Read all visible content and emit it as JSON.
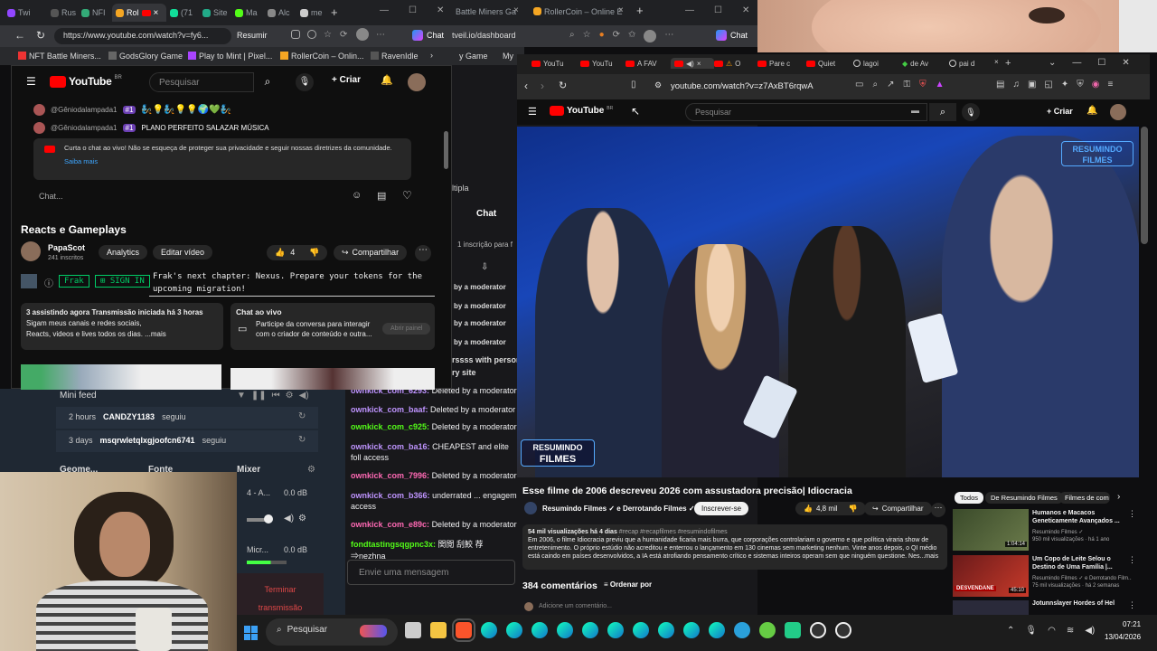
{
  "back_browser": {
    "tabs": [
      "Twi",
      "Rus",
      "NFI",
      "Rol",
      "(71",
      "Site",
      "Ma",
      "Alc",
      "me"
    ],
    "tabs2": [
      "Battle Miners Ga",
      "RollerCoin – Online E"
    ],
    "url_left": "https://www.youtube.com/watch?v=fy6...",
    "resumir": "Resumir",
    "chat_label": "Chat",
    "url_right": "tveil.io/dashboard",
    "chat_label2": "Chat"
  },
  "bookmarks": [
    "NFT Battle Miners...",
    "GodsGlory Game",
    "Play to Mint | Pixel...",
    "RollerCoin – Onlin...",
    "RavenIdle",
    "y Game",
    "My"
  ],
  "win1": {
    "logo": "YouTube",
    "country": "BR",
    "search_placeholder": "Pesquisar",
    "create": "Criar",
    "chat_msgs": [
      {
        "user": "@Gêniodalampada1",
        "badge": "#1",
        "text": "🧞💡🧞💡💡🌍💚🧞"
      },
      {
        "user": "@Gêniodalampada1",
        "badge": "#1",
        "text": "PLANO PERFEITO SALAZAR MÚSICA"
      }
    ],
    "notice": "Curta o chat ao vivo! Não se esqueça de proteger sua privacidade e seguir nossas diretrizes da comunidade.",
    "notice_link": "Saiba mais",
    "chat_placeholder": "Chat...",
    "video_title": "Reacts e Gameplays",
    "channel": "PapaScot",
    "subs": "241 inscritos",
    "analytics": "Analytics",
    "edit": "Editar vídeo",
    "likes": "4",
    "share": "Compartilhar",
    "frak_label": "Frak",
    "sign_in": "SIGN IN",
    "frak_msg_1": "Frak's next chapter: Nexus. Prepare your tokens for the",
    "frak_msg_2": "upcoming migration!",
    "desc_1": "3 assistindo agora  Transmissão iniciada há 3 horas",
    "desc_2": "Sigam meus canais e redes sociais,",
    "desc_3": "Reacts, videos e lives todos os dias. ...mais",
    "livechat_title": "Chat ao vivo",
    "livechat_desc_1": "Participe da conversa para interagir",
    "livechat_desc_2": "com o criador de conteúdo e outra...",
    "livechat_btn": "Abrir painel"
  },
  "stream_page": {
    "multipla": "ltipla",
    "chat_tab": "Chat",
    "sub_text": "1 inscrição para f",
    "mod_lines": [
      "by a moderator",
      "by a moderator",
      "by a moderator",
      "by a moderator",
      "by a moderator"
    ],
    "person_1": "rssss with person",
    "person_2": "ry site",
    "chat": [
      {
        "user": "ownkick_com_6293:",
        "text": "Deleted by a moderator"
      },
      {
        "user": "ownkick_com_baaf:",
        "text": "Deleted by a moderator"
      },
      {
        "user": "ownkick_com_c925:",
        "text": "Deleted by a moderator"
      },
      {
        "user": "ownkick_com_ba16:",
        "text": "CHEAPEST and elite foll access"
      },
      {
        "user": "ownkick_com_7996:",
        "text": "Deleted by a moderator"
      },
      {
        "user": "ownkick_com_b366:",
        "text": "underrated ... engagem access"
      },
      {
        "user": "ownkick_com_e89c:",
        "text": "Deleted by a moderator"
      },
      {
        "user": "fondtastingsqgpnc3x:",
        "text": "関閲 刮鮫 荐 ⇒nezhna"
      }
    ],
    "send_placeholder": "Envie uma mensagem"
  },
  "dashboard": {
    "mini_feed": "Mini feed",
    "feed": [
      {
        "time": "2 hours",
        "user": "CANDZY1183",
        "action": "seguiu"
      },
      {
        "time": "3 days",
        "user": "msqrwletqlxgjoofcn6741",
        "action": "seguiu"
      }
    ],
    "geome": "Geome...",
    "fonte": "Fonte",
    "mixer": "Mixer",
    "mix1_label": "4 - A...",
    "mix1_db": "0.0 dB",
    "mix2_label": "Micr...",
    "mix2_db": "0.0 dB",
    "end_1": "Terminar",
    "end_2": "transmissão"
  },
  "win2": {
    "tabs": [
      "YouTu",
      "YouTu",
      "A FAV",
      "",
      "O",
      "Pare c",
      "Quiet",
      "lagoi",
      "de Av",
      "pai d"
    ],
    "url": "youtube.com/watch?v=z7AxBT6rqwA",
    "logo": "YouTube",
    "country": "BR",
    "search_placeholder": "Pesquisar",
    "create": "Criar",
    "watermark_1": "RESUMINDO",
    "watermark_2": "FILMES",
    "logo_bl_1": "RESUMINDO",
    "logo_bl_2": "FILMES",
    "title": "Esse filme de 2006 descreveu 2026 com assustadora precisão| Idiocracia",
    "channel": "Resumindo Filmes ✓ e Derrotando Filmes ✓",
    "subscribe": "Inscrever-se",
    "likes": "4,8 mil",
    "share": "Compartilhar",
    "views": "54 mil visualizações  há 4 dias",
    "tags": "#recap #recapfilmes #resumindofilmes",
    "desc": "Em 2006, o filme Idiocracia previu que a humanidade ficaria mais burra, que corporações controlariam o governo e que política viraria show de entretenimento. O próprio estúdio não acreditou e enterrou o lançamento em 130 cinemas sem marketing nenhum. Vinte anos depois, o QI médio está caindo em países desenvolvidos, a IA está atrofiando pensamento crítico e sistemas inteiros operam sem que ninguém questione. Nes...mais",
    "comments": "384 comentários",
    "sort": "Ordenar por",
    "add_comment": "Adicione um comentário...",
    "chips": [
      "Todos",
      "De Resumindo Filmes",
      "Filmes de com"
    ],
    "recs": [
      {
        "title": "Humanos e Macacos Geneticamente Avançados ...",
        "channel": "Resumindo Filmes ✓",
        "meta": "950 mil visualizações · há 1 ano",
        "duration": "1:04:14",
        "thumb_label": ""
      },
      {
        "title": "Um Copo de Leite Selou o Destino de Uma Família |...",
        "channel": "Resumindo Filmes ✓ e Derrotando Film...",
        "meta": "75 mil visualizações · há 2 semanas",
        "duration": "45:10",
        "thumb_label": "DESVENDANE"
      },
      {
        "title": "Jotunnslayer Hordes of Hel",
        "channel": "",
        "meta": "",
        "duration": "",
        "thumb_label": ""
      }
    ]
  },
  "taskbar": {
    "search": "Pesquisar",
    "time": "07:21",
    "date": "13/04/2026"
  },
  "colors": {
    "yt_red": "#ff0000",
    "twitch_purple": "#9146ff",
    "kick_green": "#53fc18",
    "dash_bg": "#1f2833"
  }
}
